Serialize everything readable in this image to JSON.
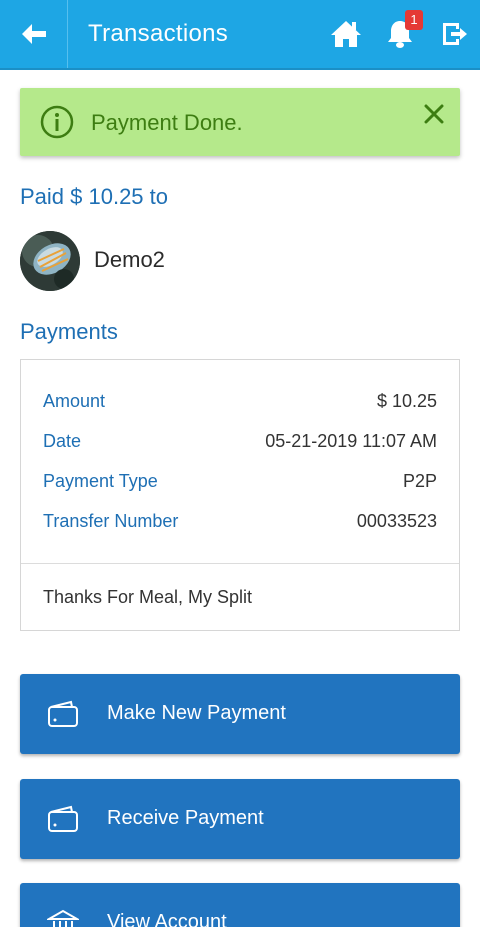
{
  "header": {
    "title": "Transactions",
    "notification_count": "1",
    "icons": [
      "back-arrow-icon",
      "home-icon",
      "bell-icon",
      "logout-icon"
    ],
    "bar_color": "#1ea6e4"
  },
  "alert": {
    "message": "Payment Done.",
    "icon": "info-icon",
    "close_icon": "close-icon",
    "bg_color": "#b5e98b"
  },
  "payment": {
    "paid_label": "Paid $ 10.25 to",
    "payee_name": "Demo2"
  },
  "payments_section": {
    "title": "Payments",
    "rows": [
      {
        "label": "Amount",
        "value": "$ 10.25"
      },
      {
        "label": "Date",
        "value": "05-21-2019 11:07 AM"
      },
      {
        "label": "Payment Type",
        "value": "P2P"
      },
      {
        "label": "Transfer Number",
        "value": "00033523"
      }
    ],
    "memo": "Thanks For Meal, My Split"
  },
  "actions": [
    {
      "label": "Make New Payment",
      "icon": "wallet-icon"
    },
    {
      "label": "Receive Payment",
      "icon": "wallet-icon"
    },
    {
      "label": "View Account",
      "icon": "bank-icon"
    }
  ],
  "colors": {
    "accent": "#1e6fb4",
    "button": "#2174bf"
  }
}
